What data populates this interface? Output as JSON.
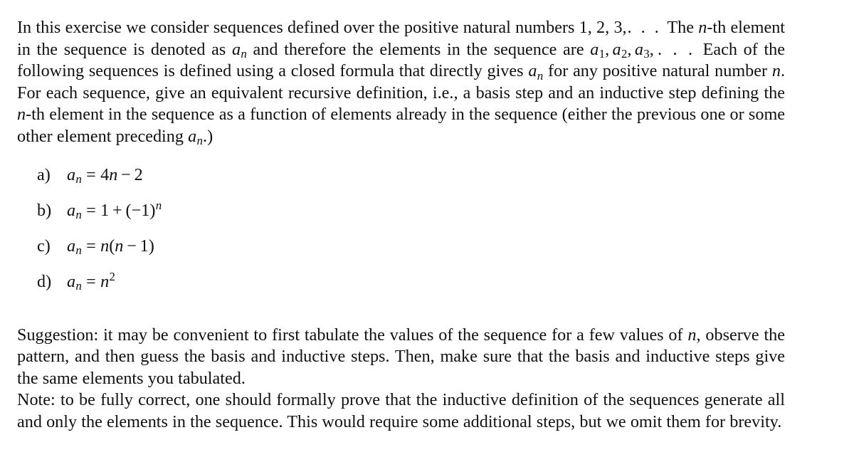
{
  "document": {
    "type": "math-exercise",
    "background_color": "#ffffff",
    "text_color": "#111111",
    "intro": {
      "segments": [
        "In this exercise we consider sequences defined over the positive natural numbers ",
        "1, 2, 3, . . .",
        " The ",
        "n",
        "-th element in the sequence is denoted as ",
        "a_n",
        " and therefore the elements in the sequence are ",
        "a_1, a_2, a_3, . . .",
        " Each of the following sequences is defined using a closed formula that directly gives ",
        "a_n",
        " for any positive natural number ",
        "n",
        ". For each sequence, give an equivalent recursive definition, i.e., a basis step and an inductive step defining the ",
        "n",
        "-th element in the sequence as a function of elements already in the sequence (either the previous one or some other element preceding ",
        "a_n",
        ".)"
      ],
      "text_part_1": "In this exercise we consider sequences defined over the positive natural numbers ",
      "numbers_list": "1, 2, 3,",
      "ellipsis": ". . .",
      "text_part_2": " The ",
      "var_n": "n",
      "text_part_3": "-th element in the sequence is denoted as ",
      "var_a": "a",
      "sub_n": "n",
      "text_part_4": " and therefore the elements in the sequence are ",
      "text_part_5": " Each of the following sequences is defined using a closed formula that directly gives ",
      "text_part_6": " for any positive natural number ",
      "text_part_7": ". For each sequence, give an equivalent recursive definition, i.e., a basis step and an inductive step defining the ",
      "text_part_8": "-th element in the sequence as a function of elements already in the sequence (either the previous one or some other element preceding ",
      "text_part_9": ".)"
    },
    "exercises": [
      {
        "label": "a)",
        "formula_text": "a_n = 4n - 2",
        "lhs_var": "a",
        "lhs_sub": "n",
        "equals": "=",
        "coefficient": "4",
        "rhs_var": "n",
        "operator": "−",
        "constant": "2"
      },
      {
        "label": "b)",
        "formula_text": "a_n = 1 + (-1)^n",
        "lhs_var": "a",
        "lhs_sub": "n",
        "equals": "=",
        "constant_one": "1",
        "operator": "+",
        "open_paren": "(",
        "minus": "−",
        "base": "1",
        "close_paren": ")",
        "exponent": "n"
      },
      {
        "label": "c)",
        "formula_text": "a_n = n(n - 1)",
        "lhs_var": "a",
        "lhs_sub": "n",
        "equals": "=",
        "factor_var": "n",
        "open_paren": "(",
        "inner_var": "n",
        "operator": "−",
        "constant": "1",
        "close_paren": ")"
      },
      {
        "label": "d)",
        "formula_text": "a_n = n^2",
        "lhs_var": "a",
        "lhs_sub": "n",
        "equals": "=",
        "base_var": "n",
        "exponent": "2"
      }
    ],
    "suggestion": {
      "lead": "Suggestion: it may be convenient to first tabulate the values of the sequence for a few values of ",
      "var_n": "n",
      "tail": ", observe the pattern, and then guess the basis and inductive steps. Then, make sure that the basis and inductive steps give the same elements you tabulated."
    },
    "note": {
      "text": "Note: to be fully correct, one should formally prove that the inductive definition of the sequences generate all and only the elements in the sequence. This would require some additional steps, but we omit them for brevity."
    }
  }
}
